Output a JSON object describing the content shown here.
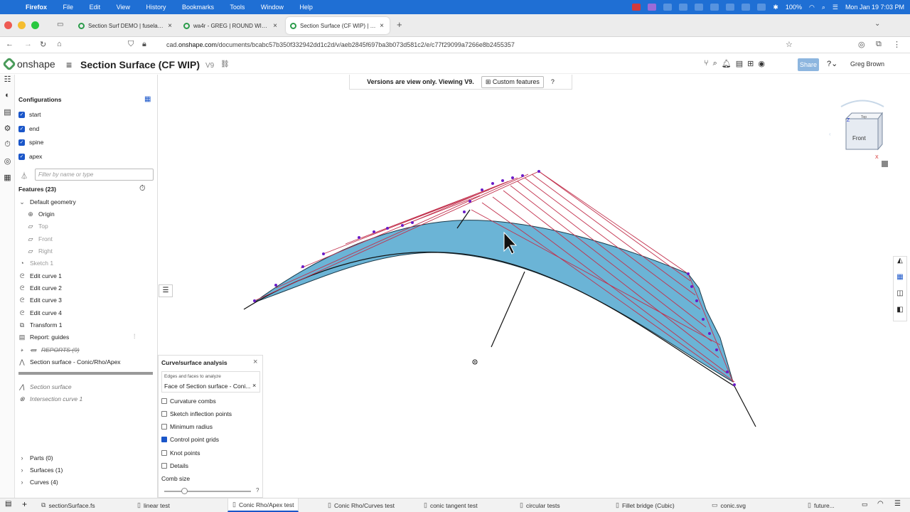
{
  "mac_menubar": {
    "app": "Firefox",
    "menus": [
      "File",
      "Edit",
      "View",
      "History",
      "Bookmarks",
      "Tools",
      "Window",
      "Help"
    ],
    "battery": "100%",
    "clock": "Mon Jan 19  7:03 PM"
  },
  "browser": {
    "tabs": [
      {
        "label": "Section Surf DEMO | fuselage cr"
      },
      {
        "label": "wa4r - GREG | ROUND WINGTIP"
      },
      {
        "label": "Section Surface (CF WIP) | Coni"
      }
    ],
    "url_prefix": "cad.",
    "url_domain": "onshape.com",
    "url_path": "/documents/bcabc57b350f332942dd1c2d/v/aeb2845f697ba3b073d581c2/e/c77f29099a7266e8b2455357"
  },
  "app": {
    "logo_text": "onshape",
    "doc_title": "Section Surface (CF WIP)",
    "version": "V9",
    "share_label": "Share",
    "user_name": "Greg Brown"
  },
  "banner": {
    "text": "Versions are view only. Viewing V9.",
    "button": "Custom features"
  },
  "configurations": {
    "title": "Configurations",
    "items": [
      {
        "label": "start"
      },
      {
        "label": "end"
      },
      {
        "label": "spine"
      },
      {
        "label": "apex"
      }
    ]
  },
  "feature_tree": {
    "filter_placeholder": "Filter by name or type",
    "title": "Features (23)",
    "default_geometry": "Default geometry",
    "origin": "Origin",
    "planes": [
      "Top",
      "Front",
      "Right"
    ],
    "items": [
      {
        "label": "Sketch 1"
      },
      {
        "label": "Edit curve 1"
      },
      {
        "label": "Edit curve 2"
      },
      {
        "label": "Edit curve 3"
      },
      {
        "label": "Edit curve 4"
      },
      {
        "label": "Transform 1"
      },
      {
        "label": "Report: guides"
      },
      {
        "label": "REPORTS (9)"
      },
      {
        "label": "Section surface - Conic/Rho/Apex"
      }
    ],
    "suppressed": [
      "Section surface",
      "Intersection curve 1"
    ],
    "parts": "Parts (0)",
    "surfaces": "Surfaces (1)",
    "curves": "Curves (4)"
  },
  "analysis": {
    "title": "Curve/surface analysis",
    "field_label": "Edges and faces to analyze",
    "field_value": "Face of Section surface - Coni...",
    "options": [
      {
        "label": "Curvature combs",
        "checked": false
      },
      {
        "label": "Sketch inflection points",
        "checked": false
      },
      {
        "label": "Minimum radius",
        "checked": false
      },
      {
        "label": "Control point grids",
        "checked": true
      },
      {
        "label": "Knot points",
        "checked": false
      },
      {
        "label": "Details",
        "checked": false
      }
    ],
    "comb_size_label": "Comb size"
  },
  "view_cube": {
    "face_label": "Front",
    "top_label": "Top"
  },
  "bottom_tabs": [
    {
      "label": "sectionSurface.fs"
    },
    {
      "label": "linear test"
    },
    {
      "label": "Conic Rho/Apex test"
    },
    {
      "label": "Conic Rho/Curves test"
    },
    {
      "label": "conic tangent test"
    },
    {
      "label": "circular tests"
    },
    {
      "label": "Fillet bridge (Cubic)"
    },
    {
      "label": "conic.svg"
    },
    {
      "label": "future..."
    }
  ],
  "colors": {
    "mac_blue": "#1f6fd4",
    "accent": "#1a56c9",
    "surface": "#6bb4d6",
    "control_lines": "#c2314d",
    "control_points": "#6a1cc7"
  }
}
